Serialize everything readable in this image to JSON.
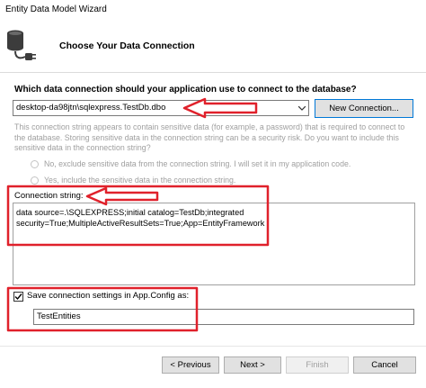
{
  "window": {
    "title": "Entity Data Model Wizard"
  },
  "header": {
    "title": "Choose Your Data Connection",
    "icon": "database-plug-icon"
  },
  "connection": {
    "question": "Which data connection should your application use to connect to the database?",
    "selected": "desktop-da98jtn\\sqlexpress.TestDb.dbo",
    "new_button": "New Connection..."
  },
  "sensitive": {
    "info": "This connection string appears to contain sensitive data (for example, a password) that is required to connect to the database. Storing sensitive data in the connection string can be a security risk. Do you want to include this sensitive data in the connection string?",
    "option_no": "No, exclude sensitive data from the connection string. I will set it in my application code.",
    "option_yes": "Yes, include the sensitive data in the connection string."
  },
  "connection_string": {
    "label": "Connection string:",
    "value": "data source=.\\SQLEXPRESS;initial catalog=TestDb;integrated security=True;MultipleActiveResultSets=True;App=EntityFramework"
  },
  "save": {
    "checked": true,
    "label": "Save connection settings in App.Config as:",
    "value": "TestEntities"
  },
  "footer": {
    "previous": "< Previous",
    "next": "Next >",
    "finish": "Finish",
    "cancel": "Cancel"
  },
  "colors": {
    "annotation": "#e0212b",
    "accent": "#0078d7",
    "disabled_text": "#9f9f9f"
  }
}
